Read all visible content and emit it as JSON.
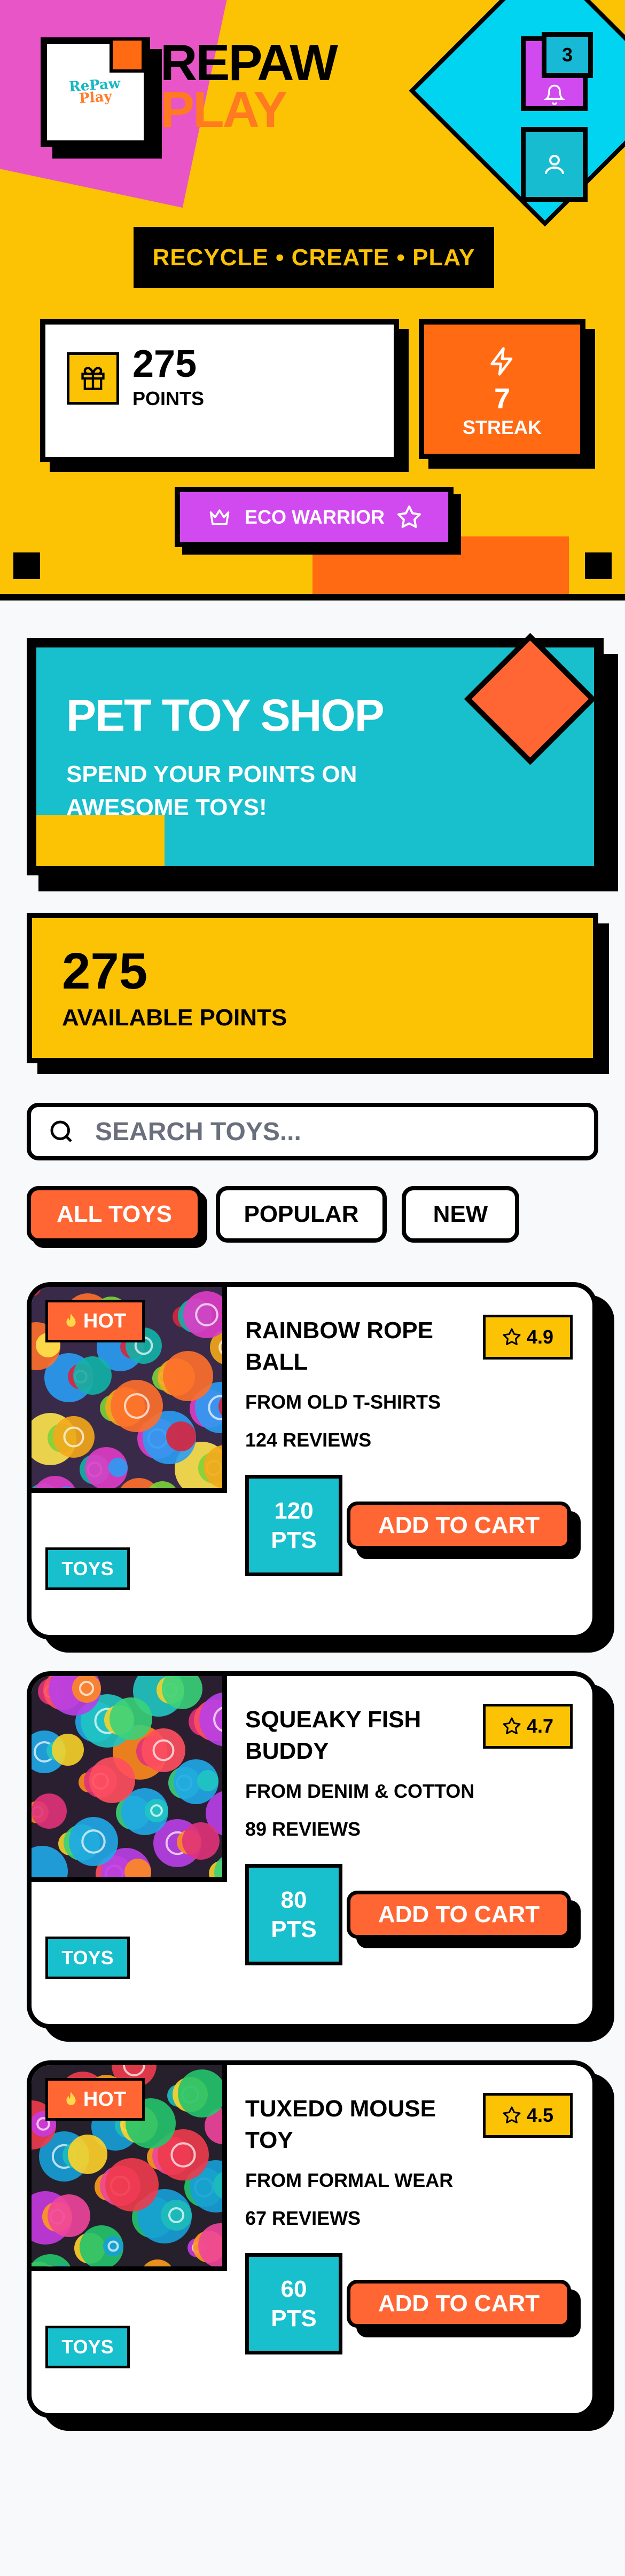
{
  "brand": {
    "line1": "REPAW",
    "line2": "PLAY",
    "logo_text_1": "RePaw",
    "logo_text_2": "Play"
  },
  "notifications": {
    "count": "3",
    "icon": "bell-icon"
  },
  "user": {
    "icon": "user-icon"
  },
  "tagline": "RECYCLE • CREATE • PLAY",
  "stats": {
    "points_value": "275",
    "points_label": "POINTS",
    "points_icon": "gift-icon",
    "streak_value": "7",
    "streak_label": "STREAK",
    "streak_icon": "lightning-icon"
  },
  "badge": {
    "label": "ECO WARRIOR",
    "left_icon": "crown-icon",
    "right_icon": "star-icon"
  },
  "shop": {
    "title": "PET TOY SHOP",
    "subtitle": "SPEND YOUR POINTS ON AWESOME TOYS!"
  },
  "available": {
    "value": "275",
    "label": "AVAILABLE POINTS"
  },
  "search": {
    "placeholder": "SEARCH TOYS..."
  },
  "filters": [
    {
      "label": "ALL TOYS",
      "active": true
    },
    {
      "label": "POPULAR",
      "active": false
    },
    {
      "label": "NEW",
      "active": false
    }
  ],
  "products": [
    {
      "name": "RAINBOW ROPE BALL",
      "rating": "4.9",
      "origin": "FROM OLD T-SHIRTS",
      "reviews": "124 REVIEWS",
      "price_value": "120",
      "price_unit": "PTS",
      "category": "TOYS",
      "hot": true,
      "hot_label": "HOT",
      "cart_label": "ADD TO CART"
    },
    {
      "name": "SQUEAKY FISH BUDDY",
      "rating": "4.7",
      "origin": "FROM DENIM & COTTON",
      "reviews": "89 REVIEWS",
      "price_value": "80",
      "price_unit": "PTS",
      "category": "TOYS",
      "hot": false,
      "cart_label": "ADD TO CART"
    },
    {
      "name": "TUXEDO MOUSE TOY",
      "rating": "4.5",
      "origin": "FROM FORMAL WEAR",
      "reviews": "67 REVIEWS",
      "price_value": "60",
      "price_unit": "PTS",
      "category": "TOYS",
      "hot": true,
      "hot_label": "HOT",
      "cart_label": "ADD TO CART"
    }
  ],
  "colors": {
    "yellow": "#fcc204",
    "orange": "#ff6633",
    "teal": "#18bfcd",
    "pink": "#d04af0",
    "black": "#000000"
  }
}
